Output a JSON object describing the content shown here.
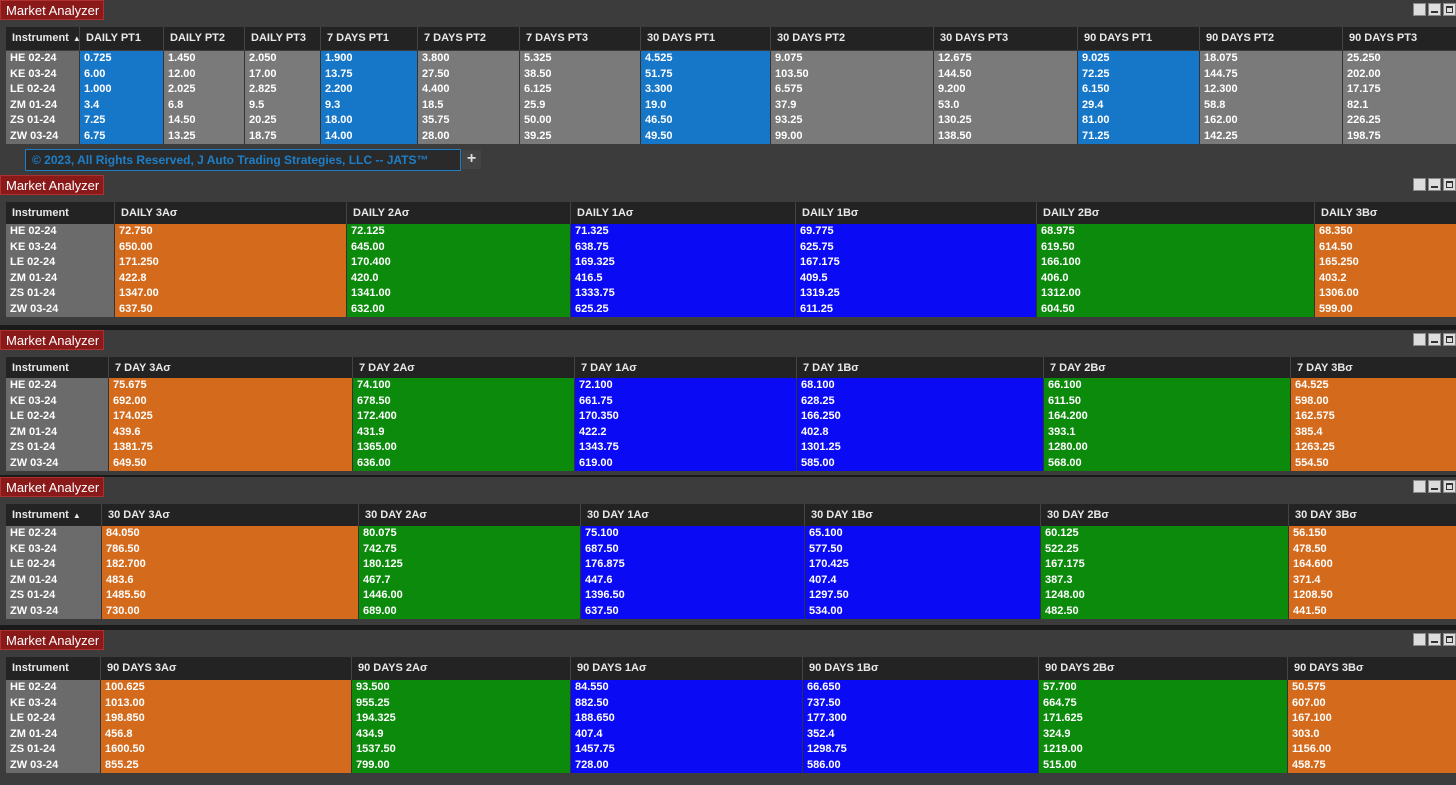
{
  "instruments": [
    "HE 02-24",
    "KE 03-24",
    "LE 02-24",
    "ZM 01-24",
    "ZS 01-24",
    "ZW 03-24"
  ],
  "colors": {
    "blue_pt": "#1677c8",
    "gray_pt": "#7a7a7a",
    "orange": "#d36a1c",
    "green": "#0b8a0b",
    "blue": "#0a0af5",
    "instrument_bg": "#6b6b6b",
    "title_red": "#8a1a1a"
  },
  "sort_icon": "sort-ascending-icon",
  "panels": [
    {
      "title": "Market Analyzer",
      "instrument_header": "Instrument",
      "sort_icon": "▲",
      "footer": "© 2023, All Rights Reserved, J Auto Trading Strategies, LLC -- JATS™",
      "add_tab": "+",
      "columns": [
        {
          "header": "DAILY PT1",
          "color": "blue_pt",
          "values": [
            "0.725",
            "6.00",
            "1.000",
            "3.4",
            "7.25",
            "6.75"
          ]
        },
        {
          "header": "DAILY PT2",
          "color": "gray_pt",
          "values": [
            "1.450",
            "12.00",
            "2.025",
            "6.8",
            "14.50",
            "13.25"
          ]
        },
        {
          "header": "DAILY PT3",
          "color": "gray_pt",
          "values": [
            "2.050",
            "17.00",
            "2.825",
            "9.5",
            "20.25",
            "18.75"
          ]
        },
        {
          "header": "7 DAYS PT1",
          "color": "blue_pt",
          "values": [
            "1.900",
            "13.75",
            "2.200",
            "9.3",
            "18.00",
            "14.00"
          ]
        },
        {
          "header": "7 DAYS PT2",
          "color": "gray_pt",
          "values": [
            "3.800",
            "27.50",
            "4.400",
            "18.5",
            "35.75",
            "28.00"
          ]
        },
        {
          "header": "7 DAYS PT3",
          "color": "gray_pt",
          "values": [
            "5.325",
            "38.50",
            "6.125",
            "25.9",
            "50.00",
            "39.25"
          ]
        },
        {
          "header": "30 DAYS PT1",
          "color": "blue_pt",
          "values": [
            "4.525",
            "51.75",
            "3.300",
            "19.0",
            "46.50",
            "49.50"
          ]
        },
        {
          "header": "30 DAYS PT2",
          "color": "gray_pt",
          "values": [
            "9.075",
            "103.50",
            "6.575",
            "37.9",
            "93.25",
            "99.00"
          ]
        },
        {
          "header": "30 DAYS PT3",
          "color": "gray_pt",
          "values": [
            "12.675",
            "144.50",
            "9.200",
            "53.0",
            "130.25",
            "138.50"
          ]
        },
        {
          "header": "90 DAYS PT1",
          "color": "blue_pt",
          "values": [
            "9.025",
            "72.25",
            "6.150",
            "29.4",
            "81.00",
            "71.25"
          ]
        },
        {
          "header": "90 DAYS PT2",
          "color": "gray_pt",
          "values": [
            "18.075",
            "144.75",
            "12.300",
            "58.8",
            "162.00",
            "142.25"
          ]
        },
        {
          "header": "90 DAYS PT3",
          "color": "gray_pt",
          "values": [
            "25.250",
            "202.00",
            "17.175",
            "82.1",
            "226.25",
            "198.75"
          ]
        }
      ]
    },
    {
      "title": "Market Analyzer",
      "instrument_header": "Instrument",
      "columns": [
        {
          "header": "DAILY 3Aσ",
          "color": "orange",
          "values": [
            "72.750",
            "650.00",
            "171.250",
            "422.8",
            "1347.00",
            "637.50"
          ]
        },
        {
          "header": "DAILY 2Aσ",
          "color": "green",
          "values": [
            "72.125",
            "645.00",
            "170.400",
            "420.0",
            "1341.00",
            "632.00"
          ]
        },
        {
          "header": "DAILY 1Aσ",
          "color": "blue",
          "values": [
            "71.325",
            "638.75",
            "169.325",
            "416.5",
            "1333.75",
            "625.25"
          ]
        },
        {
          "header": "DAILY 1Bσ",
          "color": "blue",
          "values": [
            "69.775",
            "625.75",
            "167.175",
            "409.5",
            "1319.25",
            "611.25"
          ]
        },
        {
          "header": "DAILY 2Bσ",
          "color": "green",
          "values": [
            "68.975",
            "619.50",
            "166.100",
            "406.0",
            "1312.00",
            "604.50"
          ]
        },
        {
          "header": "DAILY 3Bσ",
          "color": "orange",
          "values": [
            "68.350",
            "614.50",
            "165.250",
            "403.2",
            "1306.00",
            "599.00"
          ]
        }
      ]
    },
    {
      "title": "Market Analyzer",
      "instrument_header": "Instrument",
      "columns": [
        {
          "header": "7 DAY 3Aσ",
          "color": "orange",
          "values": [
            "75.675",
            "692.00",
            "174.025",
            "439.6",
            "1381.75",
            "649.50"
          ]
        },
        {
          "header": "7 DAY 2Aσ",
          "color": "green",
          "values": [
            "74.100",
            "678.50",
            "172.400",
            "431.9",
            "1365.00",
            "636.00"
          ]
        },
        {
          "header": "7 DAY 1Aσ",
          "color": "blue",
          "values": [
            "72.100",
            "661.75",
            "170.350",
            "422.2",
            "1343.75",
            "619.00"
          ]
        },
        {
          "header": "7 DAY 1Bσ",
          "color": "blue",
          "values": [
            "68.100",
            "628.25",
            "166.250",
            "402.8",
            "1301.25",
            "585.00"
          ]
        },
        {
          "header": "7 DAY 2Bσ",
          "color": "green",
          "values": [
            "66.100",
            "611.50",
            "164.200",
            "393.1",
            "1280.00",
            "568.00"
          ]
        },
        {
          "header": "7 DAY 3Bσ",
          "color": "orange",
          "values": [
            "64.525",
            "598.00",
            "162.575",
            "385.4",
            "1263.25",
            "554.50"
          ]
        }
      ]
    },
    {
      "title": "Market Analyzer",
      "instrument_header": "Instrument",
      "sort_icon": "▲",
      "columns": [
        {
          "header": "30 DAY 3Aσ",
          "color": "orange",
          "values": [
            "84.050",
            "786.50",
            "182.700",
            "483.6",
            "1485.50",
            "730.00"
          ]
        },
        {
          "header": "30 DAY 2Aσ",
          "color": "green",
          "values": [
            "80.075",
            "742.75",
            "180.125",
            "467.7",
            "1446.00",
            "689.00"
          ]
        },
        {
          "header": "30 DAY 1Aσ",
          "color": "blue",
          "values": [
            "75.100",
            "687.50",
            "176.875",
            "447.6",
            "1396.50",
            "637.50"
          ]
        },
        {
          "header": "30 DAY 1Bσ",
          "color": "blue",
          "values": [
            "65.100",
            "577.50",
            "170.425",
            "407.4",
            "1297.50",
            "534.00"
          ]
        },
        {
          "header": "30 DAY 2Bσ",
          "color": "green",
          "values": [
            "60.125",
            "522.25",
            "167.175",
            "387.3",
            "1248.00",
            "482.50"
          ]
        },
        {
          "header": "30 DAY 3Bσ",
          "color": "orange",
          "values": [
            "56.150",
            "478.50",
            "164.600",
            "371.4",
            "1208.50",
            "441.50"
          ]
        }
      ]
    },
    {
      "title": "Market Analyzer",
      "instrument_header": "Instrument",
      "columns": [
        {
          "header": "90 DAYS 3Aσ",
          "color": "orange",
          "values": [
            "100.625",
            "1013.00",
            "198.850",
            "456.8",
            "1600.50",
            "855.25"
          ]
        },
        {
          "header": "90 DAYS 2Aσ",
          "color": "green",
          "values": [
            "93.500",
            "955.25",
            "194.325",
            "434.9",
            "1537.50",
            "799.00"
          ]
        },
        {
          "header": "90 DAYS 1Aσ",
          "color": "blue",
          "values": [
            "84.550",
            "882.50",
            "188.650",
            "407.4",
            "1457.75",
            "728.00"
          ]
        },
        {
          "header": "90 DAYS 1Bσ",
          "color": "blue",
          "values": [
            "66.650",
            "737.50",
            "177.300",
            "352.4",
            "1298.75",
            "586.00"
          ]
        },
        {
          "header": "90 DAYS 2Bσ",
          "color": "green",
          "values": [
            "57.700",
            "664.75",
            "171.625",
            "324.9",
            "1219.00",
            "515.00"
          ]
        },
        {
          "header": "90 DAYS 3Bσ",
          "color": "orange",
          "values": [
            "50.575",
            "607.00",
            "167.100",
            "303.0",
            "1156.00",
            "458.75"
          ]
        }
      ]
    }
  ]
}
